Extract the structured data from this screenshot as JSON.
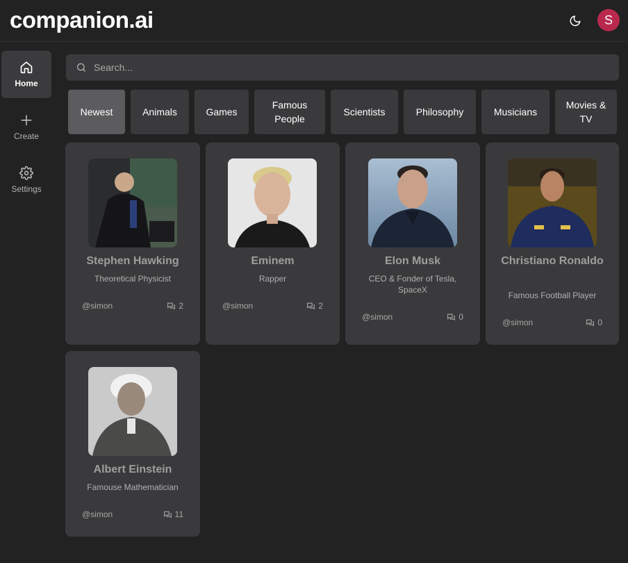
{
  "app": {
    "title": "companion.ai",
    "avatar_initial": "S"
  },
  "header": {
    "theme_icon": "moon-icon"
  },
  "sidebar": {
    "items": [
      {
        "label": "Home",
        "icon": "home-icon",
        "active": true
      },
      {
        "label": "Create",
        "icon": "plus-icon",
        "active": false
      },
      {
        "label": "Settings",
        "icon": "gear-icon",
        "active": false
      }
    ]
  },
  "search": {
    "placeholder": "Search...",
    "value": ""
  },
  "categories": [
    {
      "label": "Newest",
      "selected": true
    },
    {
      "label": "Animals",
      "selected": false
    },
    {
      "label": "Games",
      "selected": false
    },
    {
      "label": "Famous People",
      "selected": false
    },
    {
      "label": "Scientists",
      "selected": false
    },
    {
      "label": "Philosophy",
      "selected": false
    },
    {
      "label": "Musicians",
      "selected": false
    },
    {
      "label": "Movies & TV",
      "selected": false
    }
  ],
  "companions": [
    {
      "name": "Stephen Hawking",
      "description": "Theoretical Physicist",
      "author": "@simon",
      "messages": "2"
    },
    {
      "name": "Eminem",
      "description": "Rapper",
      "author": "@simon",
      "messages": "2"
    },
    {
      "name": "Elon Musk",
      "description": "CEO & Fonder of Tesla, SpaceX",
      "author": "@simon",
      "messages": "0"
    },
    {
      "name": "Christiano Ronaldo",
      "description": "Famous Football Player",
      "author": "@simon",
      "messages": "0"
    },
    {
      "name": "Albert Einstein",
      "description": "Famouse Mathematician",
      "author": "@simon",
      "messages": "11"
    }
  ],
  "colors": {
    "background": "#222223",
    "surface": "#3a3a3c",
    "selected": "#5c5c5e",
    "avatar": "#b8294d"
  }
}
